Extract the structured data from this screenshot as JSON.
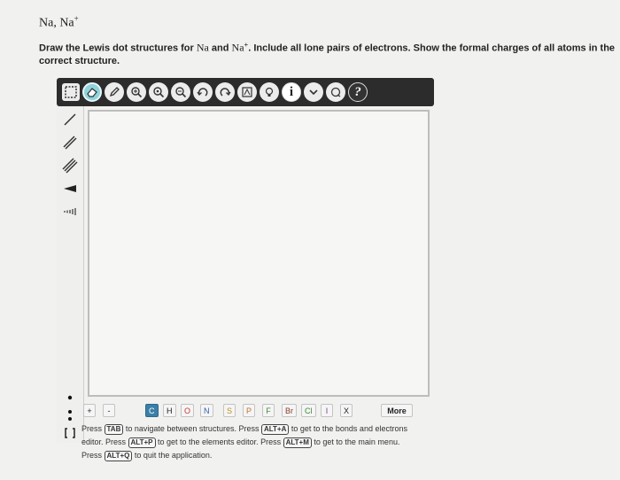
{
  "question": {
    "title_base": "Na, Na",
    "title_sup": "+",
    "text_part1": "Draw the Lewis dot structures for ",
    "species1": "Na",
    "text_and": " and ",
    "species2": "Na",
    "species2_sup": "+",
    "text_part2": ". Include all lone pairs of electrons. Show the formal charges of all atoms in the correct structure."
  },
  "toolbar": {
    "buttons": [
      "eraser-icon",
      "pencil-icon",
      "zoom-in-icon",
      "zoom-fit-icon",
      "zoom-out-icon",
      "undo-icon",
      "redo-icon",
      "template-icon",
      "bulb-icon",
      "info-icon",
      "chevron-down-icon",
      "cloud-icon",
      "help-icon"
    ],
    "info_glyph": "i",
    "help_glyph": "?"
  },
  "left_tools": [
    "single-bond-icon",
    "double-bond-icon",
    "triple-bond-icon",
    "wedge-bond-icon",
    "hash-bond-icon",
    "radical-dot-icon",
    "lone-pair-icon",
    "bracket-icon"
  ],
  "elements": {
    "plus": "+",
    "minus": "-",
    "items": [
      "C",
      "H",
      "O",
      "N",
      "S",
      "P",
      "F",
      "Br",
      "Cl",
      "I",
      "X"
    ],
    "more": "More"
  },
  "help": {
    "t1": "Press ",
    "k1": "TAB",
    "t2": " to navigate between structures. Press ",
    "k2": "ALT+A",
    "t3": " to get to the bonds and electrons editor. Press ",
    "k3": "ALT+P",
    "t4": " to get to the elements editor. Press ",
    "k4": "ALT+M",
    "t5": " to get to the main menu. Press ",
    "k5": "ALT+Q",
    "t6": " to quit the application."
  }
}
